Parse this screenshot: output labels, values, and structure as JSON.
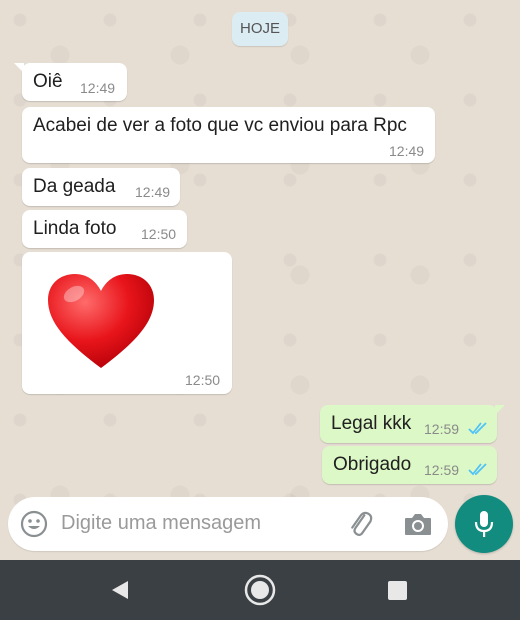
{
  "date_chip": "HOJE",
  "messages": [
    {
      "text": "Oiê",
      "time": "12:49"
    },
    {
      "text": "Acabei de ver a foto que vc enviou para Rpc",
      "time": "12:49"
    },
    {
      "text": "Da geada",
      "time": "12:49"
    },
    {
      "text": "Linda foto",
      "time": "12:50"
    },
    {
      "text": "",
      "time": "12:50",
      "sticker": "red-heart"
    },
    {
      "text": "Legal kkk",
      "time": "12:59",
      "status": "read"
    },
    {
      "text": "Obrigado",
      "time": "12:59",
      "status": "read"
    }
  ],
  "input": {
    "placeholder": "Digite uma mensagem"
  },
  "icons": {
    "emoji": "smiley-icon",
    "attach": "paperclip-icon",
    "camera": "camera-icon",
    "mic": "mic-icon",
    "nav_back": "back-triangle-icon",
    "nav_home": "home-circle-icon",
    "nav_recents": "recents-square-icon"
  },
  "colors": {
    "outgoing": "#dcf8c6",
    "incoming": "#ffffff",
    "date_chip": "#dcecf3",
    "mic_button": "#128c7e",
    "read_ticks": "#4fc3f7",
    "navbar": "#3a4043"
  }
}
